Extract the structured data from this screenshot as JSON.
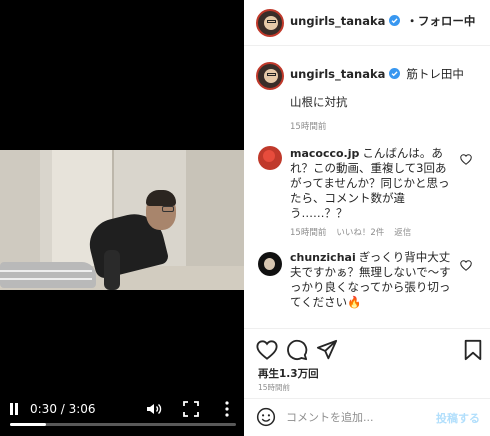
{
  "video": {
    "time_display": "0:30 / 3:06",
    "progress": 0.16,
    "icons": [
      "pause-icon",
      "volume-icon",
      "fullscreen-icon",
      "more-vertical-icon"
    ]
  },
  "header": {
    "username": "ungirls_tanaka",
    "follow_text": "・フォロー中"
  },
  "caption": {
    "username": "ungirls_tanaka",
    "extra": "筋トレ田中",
    "text": "山根に対抗",
    "time": "15時間前"
  },
  "comments": [
    {
      "username": "macocco.jp",
      "text": "こんばんは。あれ？この動画、重複して3回あがってませんか？同じかと思ったら、コメント数が違う……？？",
      "time": "15時間前",
      "likes": "いいね！2件",
      "reply": "返信"
    },
    {
      "username": "chunzichai",
      "text": "ぎっくり背中大丈夫ですかぁ？無理しないで〜すっかり良くなってから張り切ってください🔥"
    }
  ],
  "stats": {
    "views": "再生1.3万回",
    "time": "15時間前"
  },
  "add_comment": {
    "placeholder": "コメントを追加...",
    "post_label": "投稿する"
  },
  "colors": {
    "verified": "#3897f0",
    "post_button_disabled": "#b2dffc",
    "meta_text": "#8e8e8e",
    "story_ring": "#c0392b"
  }
}
